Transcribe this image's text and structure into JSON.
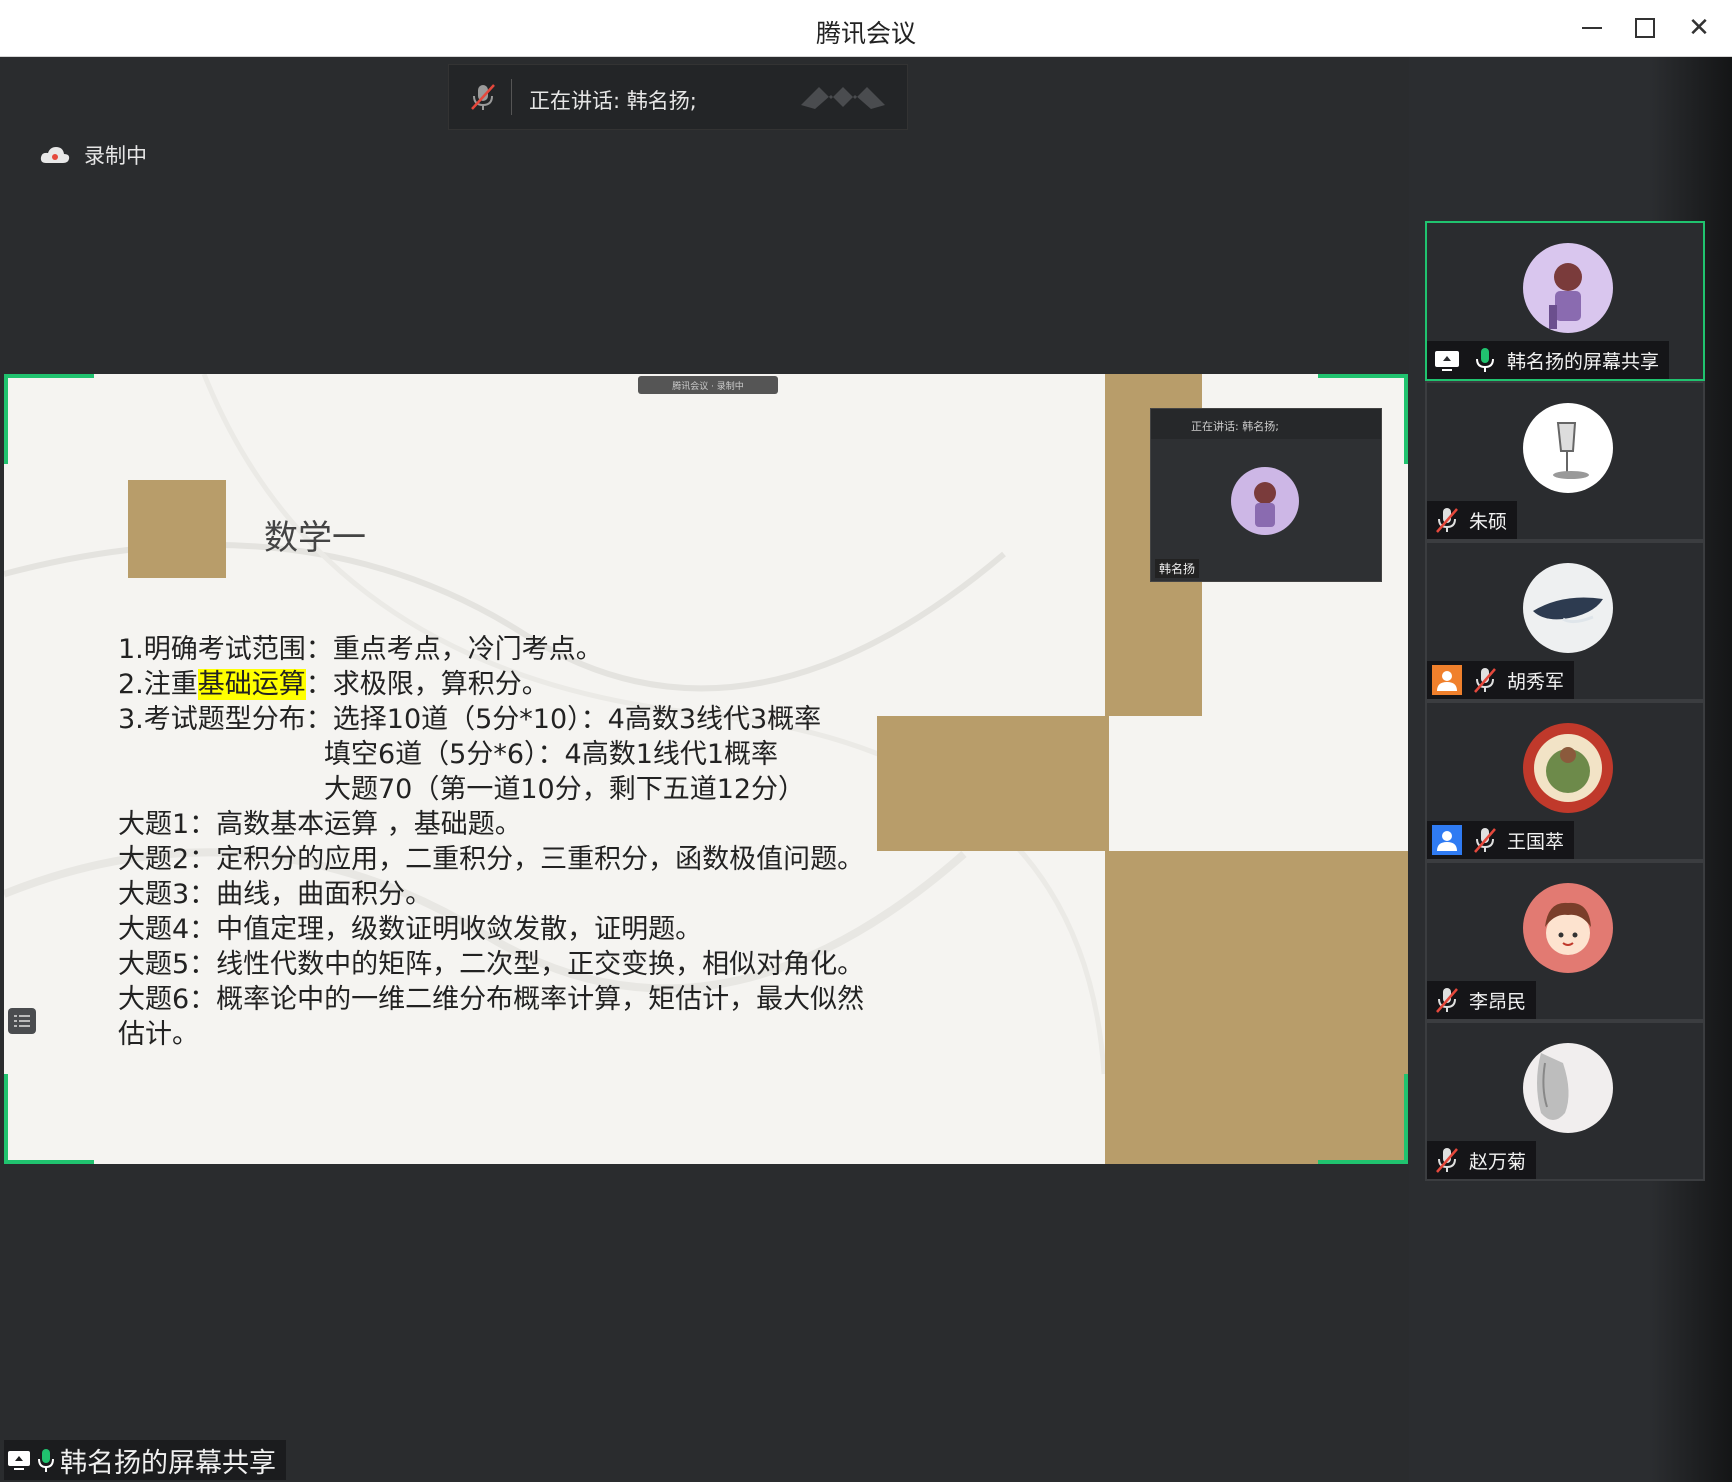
{
  "window": {
    "title": "腾讯会议"
  },
  "topbar": {
    "speaking_text": "正在讲话: 韩名扬;",
    "recording_text": "录制中"
  },
  "slide": {
    "title": "数学一",
    "lines": [
      {
        "pre": "1.明确考试范围：重点考点，冷门考点。",
        "hl": "",
        "post": ""
      },
      {
        "pre": "2.注重",
        "hl": "基础运算",
        "post": "：求极限，算积分。"
      },
      {
        "pre": "3.考试题型分布：选择10道（5分*10）：4高数3线代3概率",
        "hl": "",
        "post": ""
      },
      {
        "pre": "                        填空6道（5分*6）：4高数1线代1概率",
        "hl": "",
        "post": ""
      },
      {
        "pre": "                        大题70（第一道10分，剩下五道12分）",
        "hl": "",
        "post": ""
      },
      {
        "pre": "大题1：高数基本运算 ，基础题。",
        "hl": "",
        "post": ""
      },
      {
        "pre": "大题2：定积分的应用，二重积分，三重积分，函数极值问题。",
        "hl": "",
        "post": ""
      },
      {
        "pre": "大题3：曲线，曲面积分。",
        "hl": "",
        "post": ""
      },
      {
        "pre": "大题4：中值定理，级数证明收敛发散，证明题。",
        "hl": "",
        "post": ""
      },
      {
        "pre": "大题5：线性代数中的矩阵，二次型，正交变换，相似对角化。",
        "hl": "",
        "post": ""
      },
      {
        "pre": "大题6：概率论中的一维二维分布概率计算，矩估计，最大似然",
        "hl": "",
        "post": ""
      },
      {
        "pre": "估计。",
        "hl": "",
        "post": ""
      }
    ]
  },
  "embedded": {
    "chip_text": "腾讯会议 · 录制中",
    "mini_speaking": "正在讲话: 韩名扬;",
    "mini_name": "韩名扬"
  },
  "share_label": "韩名扬的屏幕共享",
  "participants": [
    {
      "name": "韩名扬的屏幕共享",
      "mic": "on",
      "badge": "share",
      "active": true
    },
    {
      "name": "朱硕",
      "mic": "muted",
      "badge": "",
      "active": false
    },
    {
      "name": "胡秀军",
      "mic": "muted",
      "badge": "orange-user",
      "active": false
    },
    {
      "name": "王国萃",
      "mic": "muted",
      "badge": "blue-user",
      "active": false
    },
    {
      "name": "李昂民",
      "mic": "muted",
      "badge": "",
      "active": false
    },
    {
      "name": "赵万菊",
      "mic": "muted",
      "badge": "",
      "active": false
    }
  ],
  "colors": {
    "accent": "#20c36f",
    "gold": "#b89d6a",
    "highlight": "#ffff00"
  }
}
